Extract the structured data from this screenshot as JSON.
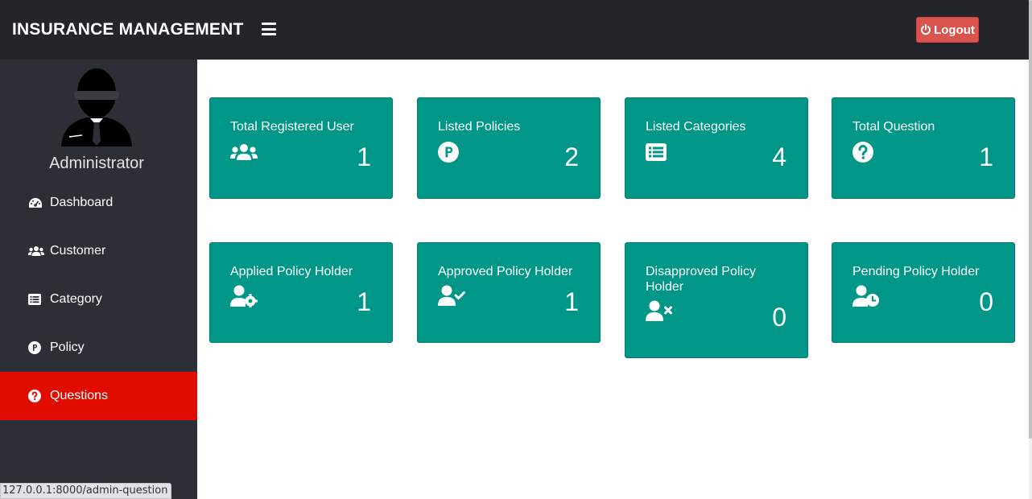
{
  "navbar": {
    "brand": "INSURANCE MANAGEMENT",
    "logout_label": "Logout",
    "logout_color": "#d9534f"
  },
  "sidebar": {
    "admin_name": "Administrator",
    "items": [
      {
        "label": "Dashboard",
        "icon": "tachometer-icon"
      },
      {
        "label": "Customer",
        "icon": "users-icon"
      },
      {
        "label": "Category",
        "icon": "list-icon"
      },
      {
        "label": "Policy",
        "icon": "parking-circle-icon"
      },
      {
        "label": "Questions",
        "icon": "question-circle-icon",
        "active": true
      }
    ]
  },
  "cards": [
    {
      "title": "Total Registered User",
      "value": "1",
      "icon": "users-icon"
    },
    {
      "title": "Listed Policies",
      "value": "2",
      "icon": "parking-circle-icon"
    },
    {
      "title": "Listed Categories",
      "value": "4",
      "icon": "list-icon"
    },
    {
      "title": "Total Question",
      "value": "1",
      "icon": "question-circle-icon"
    },
    {
      "title": "Applied Policy Holder",
      "value": "1",
      "icon": "user-cog-icon"
    },
    {
      "title": "Approved Policy Holder",
      "value": "1",
      "icon": "user-check-icon"
    },
    {
      "title": "Disapproved Policy Holder",
      "value": "0",
      "icon": "user-times-icon"
    },
    {
      "title": "Pending Policy Holder",
      "value": "0",
      "icon": "user-clock-icon"
    }
  ],
  "status_bar": {
    "url": "127.0.0.1:8000/admin-question"
  },
  "colors": {
    "card": "#009688",
    "active_nav": "#e00c00",
    "sidebar": "#2d2f36",
    "navbar": "#23252b"
  }
}
